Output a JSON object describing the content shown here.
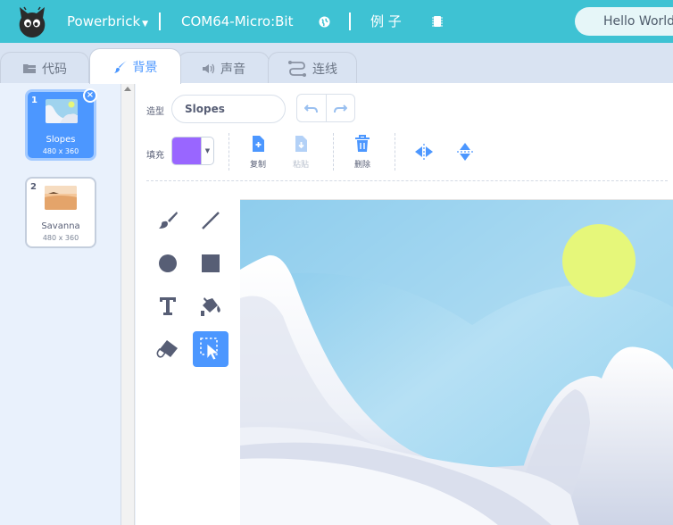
{
  "topbar": {
    "project_menu": "Powerbrick",
    "device": "COM64-Micro:Bit",
    "examples": "例 子",
    "hello": "Hello World",
    "icons": [
      "cat-logo-icon",
      "caret-down-icon",
      "globe-icon",
      "chip-icon"
    ]
  },
  "tabs": [
    {
      "label": "代码",
      "icon": "code-blocks-icon"
    },
    {
      "label": "背景",
      "icon": "paintbrush-icon"
    },
    {
      "label": "声音",
      "icon": "speaker-icon"
    },
    {
      "label": "连线",
      "icon": "wire-icon"
    }
  ],
  "costumes": [
    {
      "number": "1",
      "name": "Slopes",
      "size": "480 x 360",
      "selected": true
    },
    {
      "number": "2",
      "name": "Savanna",
      "size": "480 x 360",
      "selected": false
    }
  ],
  "editor": {
    "costume_label": "造型",
    "costume_name": "Slopes",
    "fill_label": "填充",
    "fill_color": "#9966ff",
    "actions": [
      {
        "label": "复制",
        "icon": "copy-icon"
      },
      {
        "label": "粘贴",
        "icon": "paste-icon"
      },
      {
        "label": "删除",
        "icon": "trash-icon"
      }
    ],
    "tools": [
      "brush-icon",
      "line-icon",
      "circle-icon",
      "rectangle-icon",
      "text-icon",
      "fill-icon",
      "eraser-icon",
      "select-icon"
    ],
    "active_tool": "select-icon"
  },
  "colors": {
    "topbar": "#3ec2d3",
    "accent": "#4c97ff",
    "sun": "#e6f77a"
  }
}
